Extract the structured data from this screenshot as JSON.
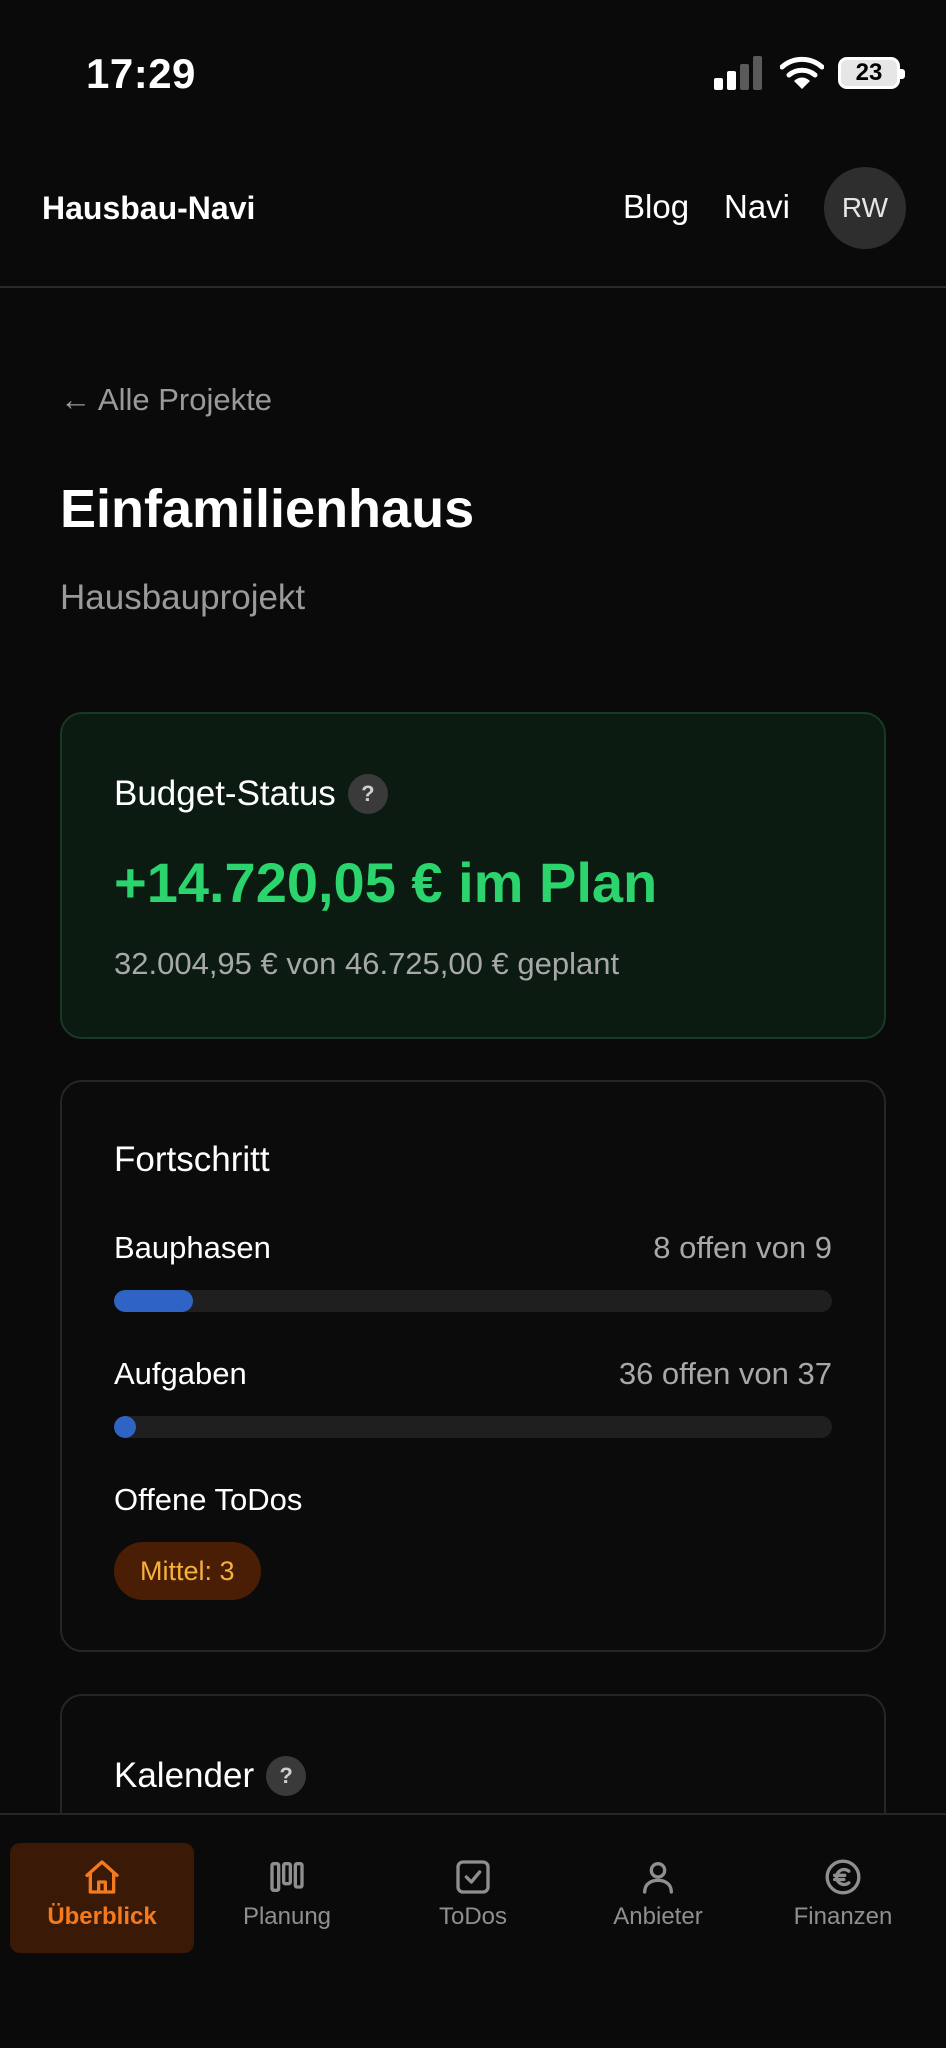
{
  "status_bar": {
    "time": "17:29",
    "battery": "23"
  },
  "header": {
    "brand": "Hausbau-Navi",
    "links": [
      "Blog",
      "Navi"
    ],
    "avatar_initials": "RW"
  },
  "page": {
    "back_link": "← Alle Projekte",
    "title": "Einfamilienhaus",
    "subtitle": "Hausbauprojekt"
  },
  "budget": {
    "title": "Budget-Status",
    "help": "?",
    "value": "+14.720,05 € im Plan",
    "detail": "32.004,95 € von 46.725,00 € geplant"
  },
  "progress": {
    "title": "Fortschritt",
    "rows": [
      {
        "label": "Bauphasen",
        "value": "8 offen von 9",
        "fraction": 0.11
      },
      {
        "label": "Aufgaben",
        "value": "36 offen von 37",
        "fraction": 0.03
      }
    ],
    "todos_label": "Offene ToDos",
    "todos_badge": "Mittel: 3"
  },
  "calendar": {
    "title": "Kalender",
    "help": "?"
  },
  "bottom_nav": [
    {
      "label": "Überblick",
      "icon": "home-icon",
      "active": true
    },
    {
      "label": "Planung",
      "icon": "columns-icon",
      "active": false
    },
    {
      "label": "ToDos",
      "icon": "checkbox-icon",
      "active": false
    },
    {
      "label": "Anbieter",
      "icon": "user-icon",
      "active": false
    },
    {
      "label": "Finanzen",
      "icon": "euro-icon",
      "active": false
    }
  ],
  "colors": {
    "accent_green": "#2bd46d",
    "accent_orange": "#f47a1f",
    "bar_blue": "#2f64c4",
    "badge_text": "#f6b13d"
  }
}
